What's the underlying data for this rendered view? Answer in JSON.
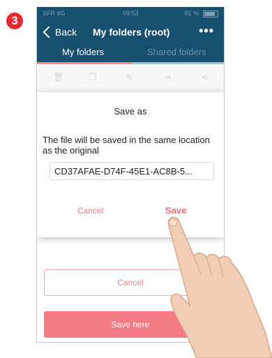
{
  "step_number": "3",
  "statusbar": {
    "carrier": "SFR 4G",
    "time": "09:53",
    "battery": "91 %"
  },
  "navbar": {
    "back_label": "Back",
    "title": "My folders (root)",
    "more_label": "•••"
  },
  "tabs": [
    {
      "label": "My folders",
      "active": true
    },
    {
      "label": "Shared folders",
      "active": false
    }
  ],
  "toolbar": {
    "icons": [
      "trash-icon",
      "copy-icon",
      "edit-icon",
      "move-icon",
      "share-icon"
    ]
  },
  "dialog": {
    "title": "Save as",
    "message": "The file will be saved in the same location as the original",
    "filename_value": "CD37AFAE-D74F-45E1-AC8B-5...",
    "cancel_label": "Cancel",
    "save_label": "Save"
  },
  "footer": {
    "cancel_label": "Cancel",
    "save_here_label": "Save here"
  },
  "colors": {
    "header": "#174f6e",
    "accent": "#f47a84",
    "badge": "#e8262d"
  }
}
